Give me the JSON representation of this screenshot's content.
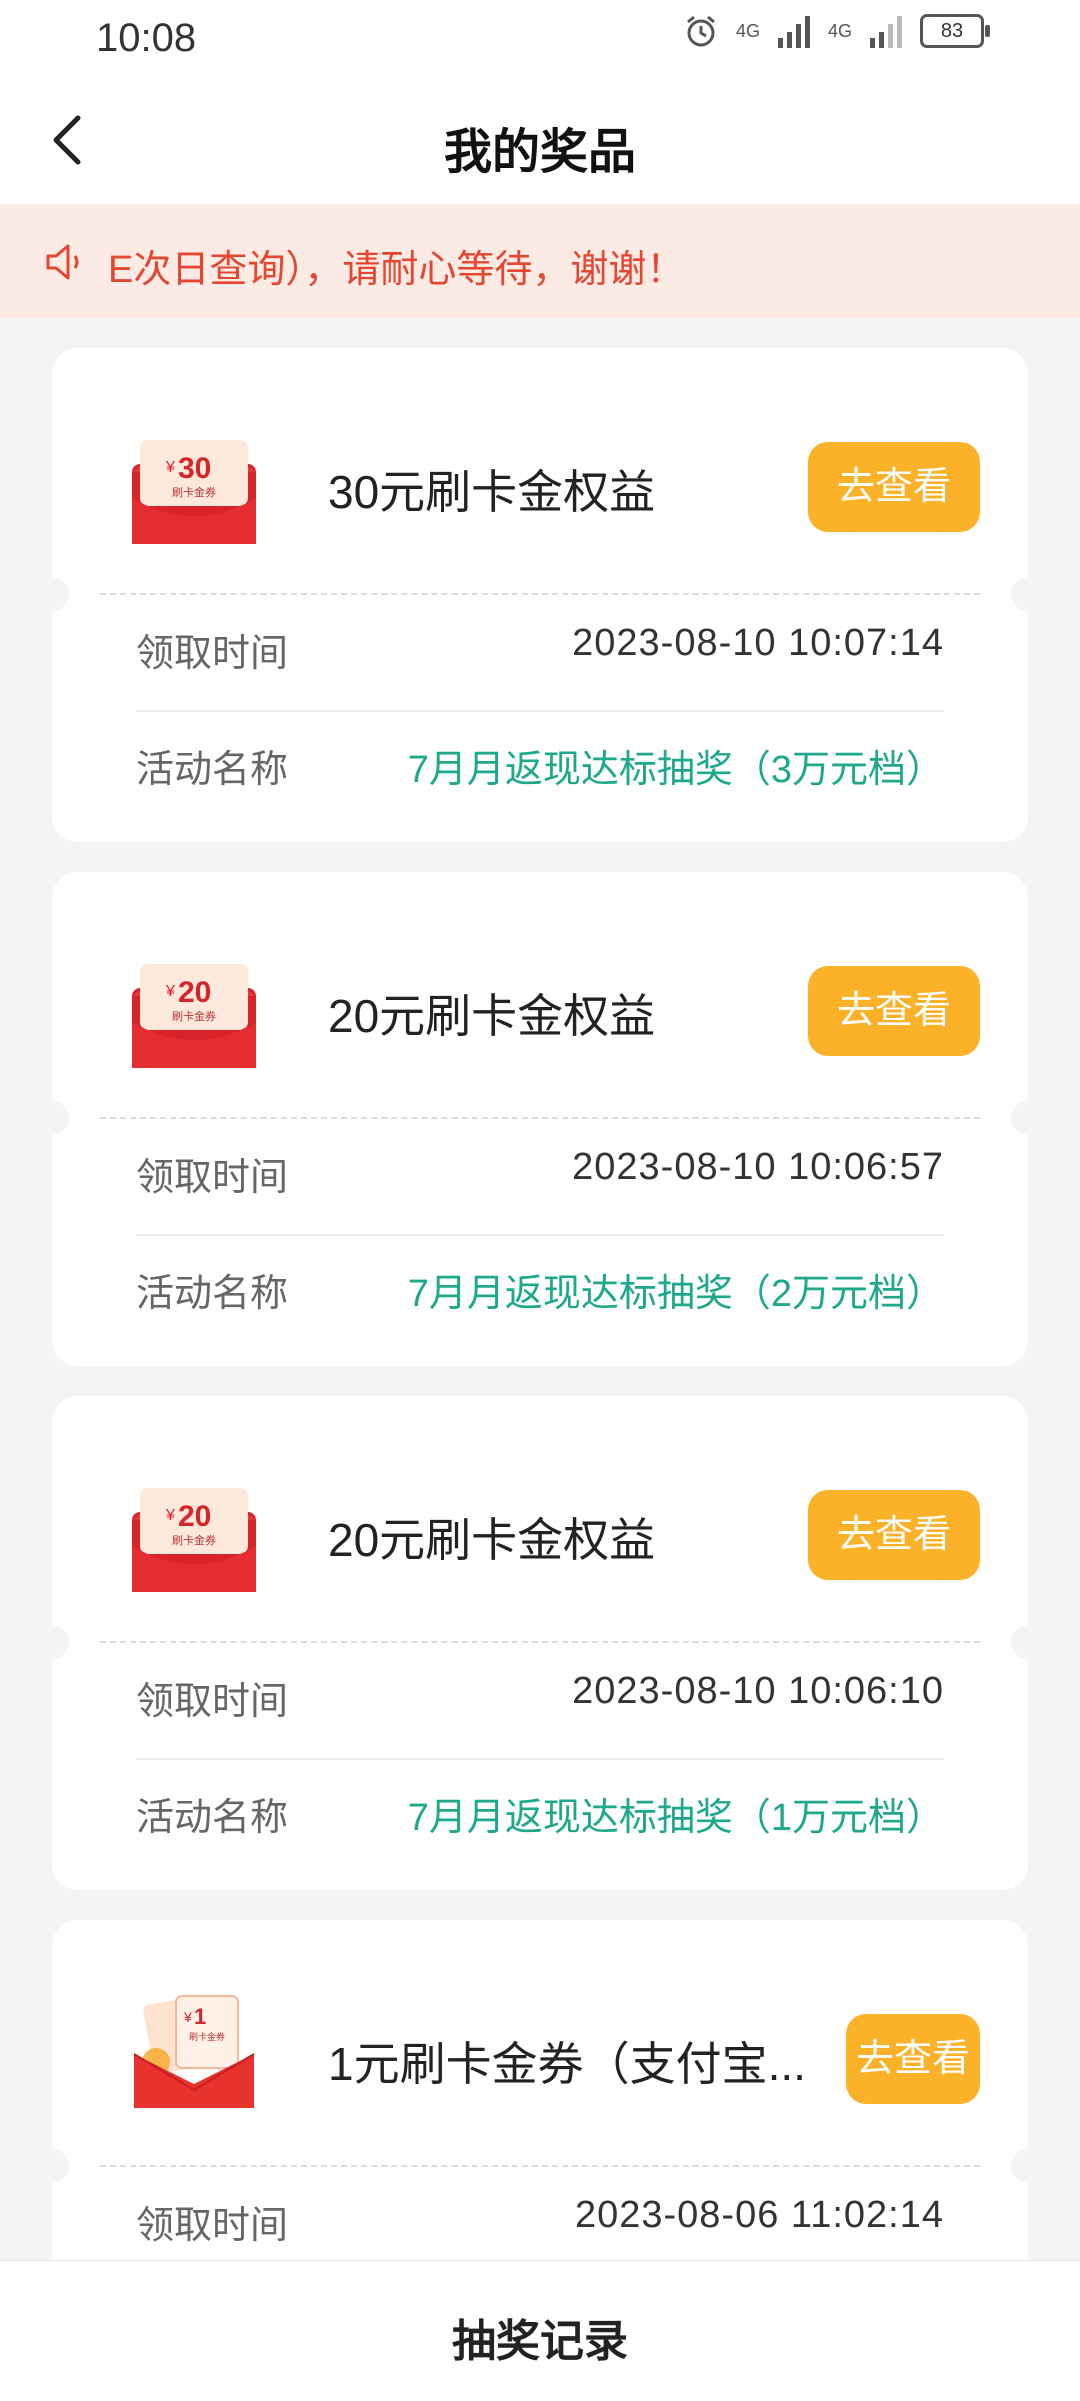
{
  "status_bar": {
    "time": "10:08",
    "network_1": "4G",
    "network_2": "4G",
    "battery": "83"
  },
  "header": {
    "title": "我的奖品"
  },
  "notice": {
    "text": "E次日查询），请耐心等待，谢谢！"
  },
  "labels": {
    "receive_time": "领取时间",
    "activity_name": "活动名称",
    "view_button": "去查看"
  },
  "prizes": [
    {
      "coupon_amount": "30",
      "coupon_tag": "刷卡金券",
      "name": "30元刷卡金权益",
      "receive_time": "2023-08-10 10:07:14",
      "activity": "7月月返现达标抽奖（3万元档）"
    },
    {
      "coupon_amount": "20",
      "coupon_tag": "刷卡金券",
      "name": "20元刷卡金权益",
      "receive_time": "2023-08-10 10:06:57",
      "activity": "7月月返现达标抽奖（2万元档）"
    },
    {
      "coupon_amount": "20",
      "coupon_tag": "刷卡金券",
      "name": "20元刷卡金权益",
      "receive_time": "2023-08-10 10:06:10",
      "activity": "7月月返现达标抽奖（1万元档）"
    },
    {
      "coupon_amount": "1",
      "coupon_tag": "刷卡金券",
      "name": "1元刷卡金券（支付宝...",
      "receive_time": "2023-08-06 11:02:14"
    }
  ],
  "bottom_bar": {
    "label": "抽奖记录"
  },
  "colors": {
    "accent": "#fbb128",
    "activity_text": "#1ea88c",
    "notice_text": "#e6452f",
    "notice_bg": "#fcebe4"
  }
}
